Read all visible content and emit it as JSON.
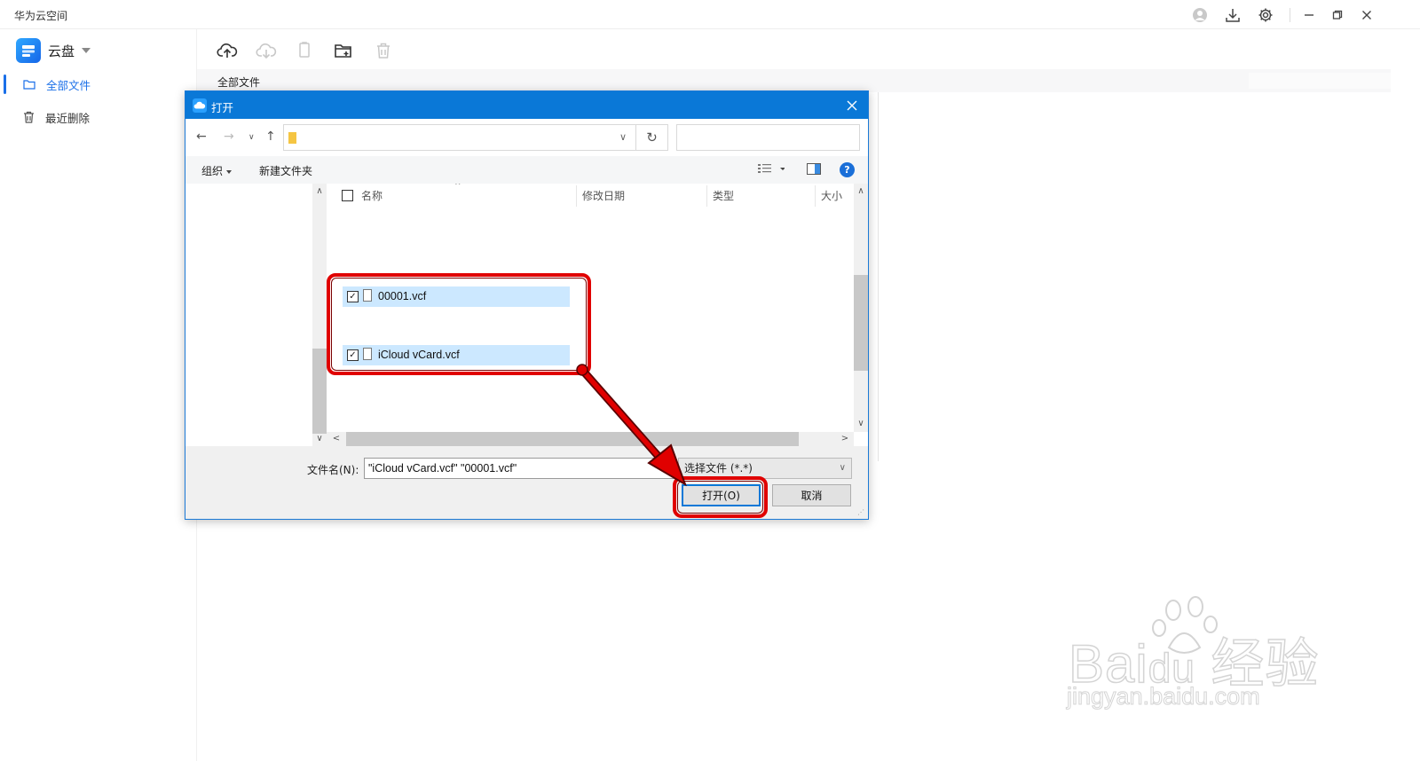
{
  "app": {
    "title": "华为云空间"
  },
  "sidebar": {
    "brand": "云盘",
    "items": [
      {
        "label": "全部文件",
        "icon": "folder-icon",
        "active": true
      },
      {
        "label": "最近删除",
        "icon": "trash-icon",
        "active": false
      }
    ]
  },
  "main": {
    "breadcrumb": "全部文件"
  },
  "dialog": {
    "title": "打开",
    "toolbar": {
      "organize": "组织",
      "new_folder": "新建文件夹"
    },
    "columns": [
      "名称",
      "修改日期",
      "类型",
      "大小"
    ],
    "files": [
      {
        "name": "00001.vcf",
        "checked": true,
        "check_mark": "✓"
      },
      {
        "name": "iCloud vCard.vcf",
        "checked": true,
        "check_mark": "✓"
      }
    ],
    "filename_label": "文件名(N):",
    "filename_value": "\"iCloud vCard.vcf\" \"00001.vcf\"",
    "filter": "选择文件 (*.*)",
    "open_button": "打开(O)",
    "cancel_button": "取消",
    "help": "?"
  },
  "annotation_color": "#e00000",
  "accent_color": "#0a78d7",
  "watermark": {
    "main": "Bai du 经验",
    "sub": "jingyan.baidu.com"
  }
}
